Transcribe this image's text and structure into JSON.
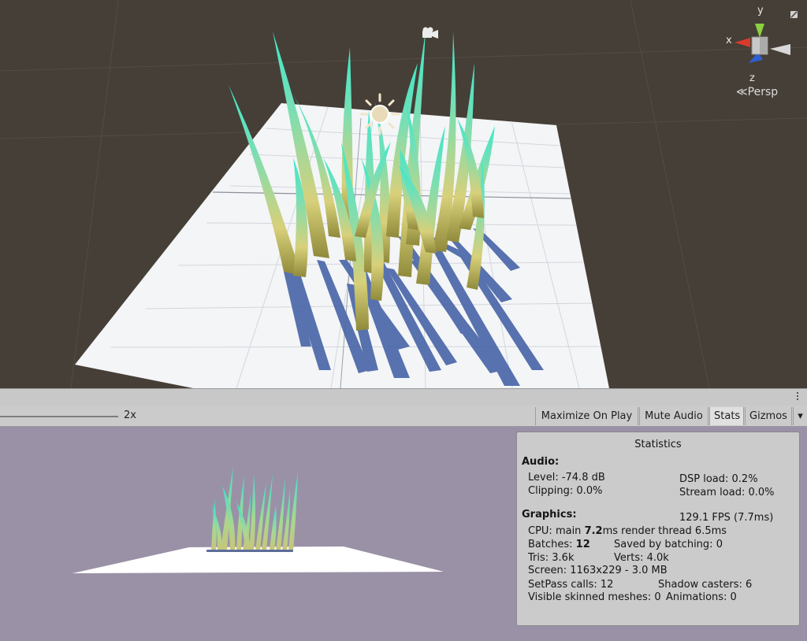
{
  "scene": {
    "axis_labels": {
      "y": "y",
      "x": "x",
      "z": "z"
    },
    "projection_label": "Persp",
    "colors": {
      "background": "#463f37",
      "plane": "#f4f5f7",
      "shadow": "#4a67a8",
      "grass_tip": "#3fe8c8",
      "grass_base": "#d8d07a"
    }
  },
  "toolbar": {
    "scale_value": "2x",
    "buttons": {
      "maximize_on_play": "Maximize On Play",
      "mute_audio": "Mute Audio",
      "stats": "Stats",
      "gizmos": "Gizmos"
    }
  },
  "game": {
    "colors": {
      "background": "#9a91a7"
    }
  },
  "stats": {
    "title": "Statistics",
    "audio": {
      "heading": "Audio:",
      "level": "Level: -74.8 dB",
      "clipping": "Clipping: 0.0%",
      "dsp_load": "DSP load: 0.2%",
      "stream_load": "Stream load: 0.0%"
    },
    "graphics": {
      "heading": "Graphics:",
      "fps": "129.1 FPS (7.7ms)",
      "cpu_prefix": "CPU: main ",
      "cpu_main": "7.2",
      "cpu_suffix": "ms  render thread 6.5ms",
      "batches_prefix": "Batches: ",
      "batches": "12",
      "saved_by_batching": "Saved by batching: 0",
      "tris": "Tris: 3.6k",
      "verts": "Verts: 4.0k",
      "screen": "Screen: 1163x229 - 3.0 MB",
      "setpass_calls": "SetPass calls: 12",
      "shadow_casters": "Shadow casters: 6",
      "visible_skinned_meshes": "Visible skinned meshes: 0",
      "animations": "Animations: 0"
    }
  }
}
